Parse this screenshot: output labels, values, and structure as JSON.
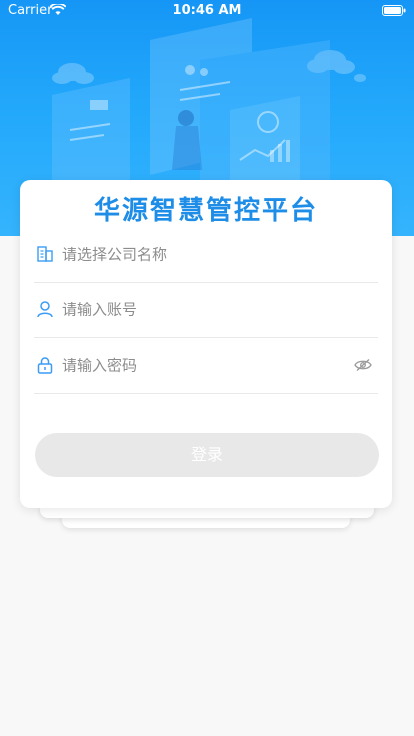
{
  "status_bar": {
    "carrier": "Carrier",
    "time": "10:46 AM"
  },
  "login": {
    "title": "华源智慧管控平台",
    "company_placeholder": "请选择公司名称",
    "account_placeholder": "请输入账号",
    "password_placeholder": "请输入密码",
    "login_label": "登录"
  },
  "icons": {
    "company": "building-icon",
    "account": "user-icon",
    "password": "lock-icon",
    "visibility": "eye-off-icon"
  },
  "colors": {
    "brand": "#1d8de7",
    "header_top": "#1596f6",
    "header_bottom": "#35b4fd",
    "button_disabled": "#e8e8e8"
  }
}
